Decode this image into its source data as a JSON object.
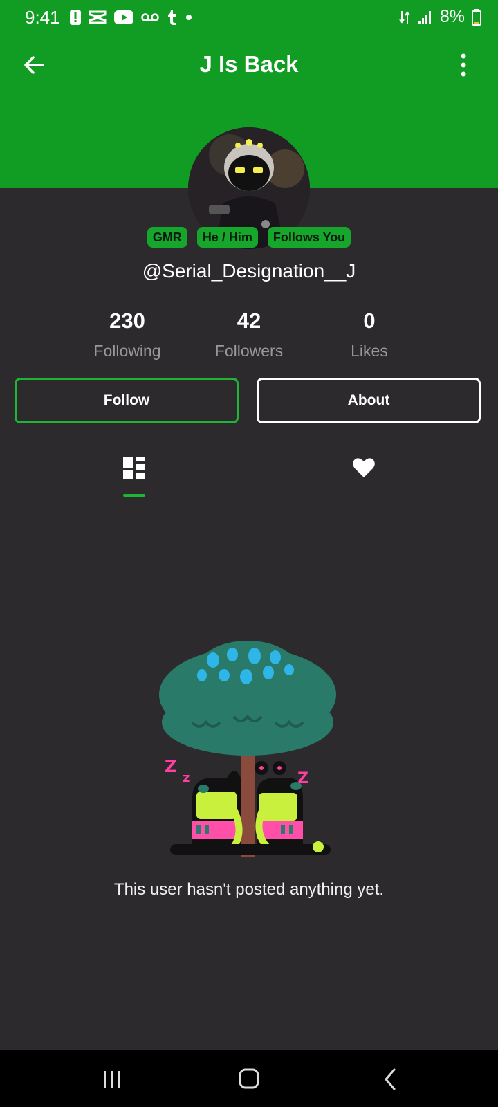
{
  "status_bar": {
    "time": "9:41",
    "battery": "8%",
    "icons": [
      "alert-icon",
      "capcut-icon",
      "youtube-icon",
      "voicemail-icon",
      "tumblr-icon",
      "dot-icon",
      "data-transfer-icon",
      "signal-icon",
      "battery-icon"
    ]
  },
  "header": {
    "title": "J Is Back",
    "back_icon": "arrow-left-icon",
    "more_icon": "more-vertical-icon",
    "color": "#119d23"
  },
  "profile": {
    "badges": [
      "GMR",
      "He / Him",
      "Follows You"
    ],
    "handle": "@Serial_Designation__J",
    "stats": [
      {
        "value": "230",
        "label": "Following"
      },
      {
        "value": "42",
        "label": "Followers"
      },
      {
        "value": "0",
        "label": "Likes"
      }
    ],
    "follow_label": "Follow",
    "about_label": "About"
  },
  "tabs": {
    "items": [
      "posts-grid-icon",
      "liked-heart-icon"
    ],
    "active": 0
  },
  "empty_state": {
    "message": "This user hasn't posted anything yet.",
    "art": "sleeping-characters-under-tree"
  },
  "nav_bar": {
    "icons": [
      "recent-apps-icon",
      "home-icon",
      "back-icon"
    ]
  },
  "colors": {
    "background": "#2d2a2e",
    "accent": "#1db533"
  }
}
